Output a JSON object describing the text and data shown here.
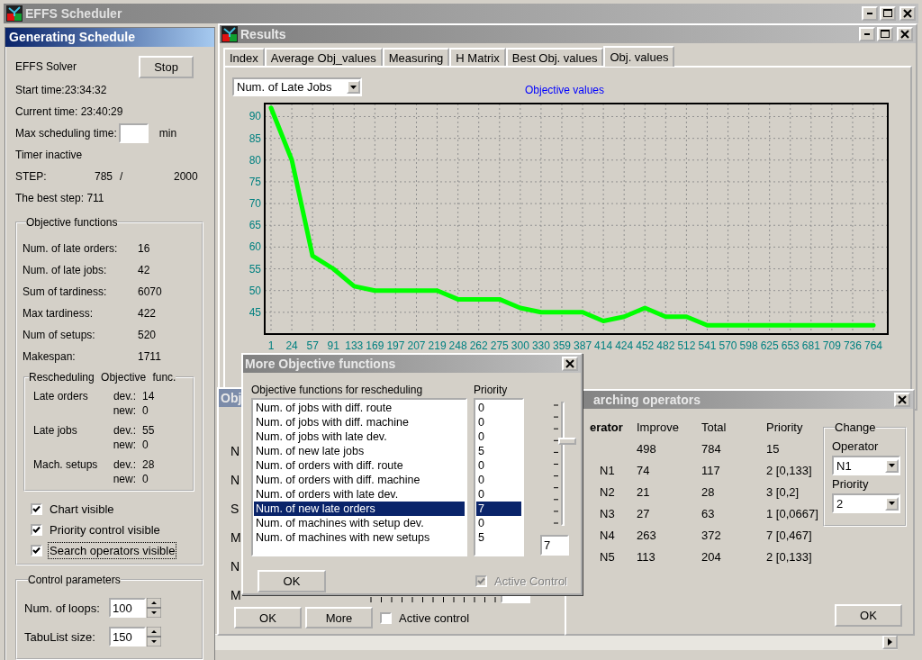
{
  "app": {
    "title": "EFFS Scheduler"
  },
  "generating_panel": {
    "title": "Generating Schedule",
    "solver_label": "EFFS Solver",
    "stop_button": "Stop",
    "start_time": "Start time:23:34:32",
    "current_time": "Current time: 23:40:29",
    "max_time": {
      "label": "Max scheduling time:",
      "unit": "min"
    },
    "timer_status": "Timer inactive",
    "step": {
      "label": "STEP:",
      "current": "785",
      "separator": "/",
      "total": "2000"
    },
    "best_step": "The best step: 711",
    "objective_functions": {
      "title": "Objective functions",
      "rows": [
        {
          "label": "Num. of late orders:",
          "value": "16"
        },
        {
          "label": "Num. of late jobs:",
          "value": "42"
        },
        {
          "label": "Sum of tardiness:",
          "value": "6070"
        },
        {
          "label": "Max tardiness:",
          "value": "422"
        },
        {
          "label": "Num of setups:",
          "value": "520"
        },
        {
          "label": "Makespan:",
          "value": "1711"
        }
      ],
      "rescheduling": {
        "title": "Rescheduling Objective func.",
        "rows": [
          {
            "label": "Late orders",
            "dev_label": "dev.:",
            "dev": "14",
            "new_label": "new:",
            "new": "0"
          },
          {
            "label": "Late jobs",
            "dev_label": "dev.:",
            "dev": "55",
            "new_label": "new:",
            "new": "0"
          },
          {
            "label": "Mach. setups",
            "dev_label": "dev.:",
            "dev": "28",
            "new_label": "new:",
            "new": "0"
          }
        ]
      },
      "checkboxes": [
        {
          "label": "Chart visible",
          "checked": true,
          "focused": false
        },
        {
          "label": "Priority control visible",
          "checked": true,
          "focused": false
        },
        {
          "label": "Search operators visible",
          "checked": true,
          "focused": true
        }
      ]
    },
    "control_parameters": {
      "title": "Control parameters",
      "fields": [
        {
          "label": "Num. of loops:",
          "value": "100"
        },
        {
          "label": "TabuList size:",
          "value": "150"
        }
      ]
    }
  },
  "results_window": {
    "title": "Results",
    "tabs": [
      {
        "label": "Index",
        "selected": false
      },
      {
        "label": "Average Obj_values",
        "selected": false
      },
      {
        "label": "Measuring",
        "selected": false
      },
      {
        "label": "H Matrix",
        "selected": false
      },
      {
        "label": "Best Obj. values",
        "selected": false
      },
      {
        "label": "Obj. values",
        "selected": true
      }
    ],
    "chart_data": {
      "type": "line",
      "title": "Objective values",
      "categories": [
        "1",
        "24",
        "57",
        "91",
        "133",
        "169",
        "197",
        "207",
        "219",
        "248",
        "262",
        "275",
        "300",
        "330",
        "359",
        "387",
        "414",
        "424",
        "452",
        "482",
        "512",
        "541",
        "570",
        "598",
        "625",
        "653",
        "681",
        "709",
        "736",
        "764"
      ],
      "series": [
        {
          "name": "Num. of Late Jobs",
          "color": "#00ff00",
          "values": [
            92,
            80,
            58,
            55,
            51,
            50,
            50,
            50,
            50,
            48,
            48,
            48,
            46,
            45,
            45,
            45,
            43,
            44,
            46,
            44,
            44,
            42,
            42,
            42,
            42,
            42,
            42,
            42,
            42,
            42
          ]
        }
      ],
      "ylim": [
        40,
        93
      ],
      "yticks": [
        45,
        50,
        55,
        60,
        65,
        70,
        75,
        80,
        85,
        90
      ],
      "grid": true
    }
  },
  "objective_window": {
    "title": "Obj",
    "row_labels": [
      "N",
      "N",
      "S",
      "M",
      "N",
      "M"
    ],
    "buttons": [
      "OK",
      "More"
    ],
    "active_control": {
      "label": "Active control",
      "checked": false
    }
  },
  "search_operators_window": {
    "title": "arching operators",
    "columns": [
      "erator",
      "Improve",
      "Total",
      "Priority"
    ],
    "rows": [
      {
        "improve": "498",
        "total": "784",
        "priority": "15"
      },
      {
        "operator": "N1",
        "improve": "74",
        "total": "117",
        "priority": "2 [0,133]"
      },
      {
        "operator": "N2",
        "improve": "21",
        "total": "28",
        "priority": "3 [0,2]"
      },
      {
        "operator": "N3",
        "improve": "27",
        "total": "63",
        "priority": "1 [0,0667]"
      },
      {
        "operator": "N4",
        "improve": "263",
        "total": "372",
        "priority": "7 [0,467]"
      },
      {
        "operator": "N5",
        "improve": "113",
        "total": "204",
        "priority": "2 [0,133]"
      }
    ],
    "change": {
      "title": "Change",
      "operator_label": "Operator",
      "operator_value": "N1",
      "priority_label": "Priority",
      "priority_value": "2"
    },
    "ok_button": "OK"
  },
  "more_dialog": {
    "title": "More Objective functions",
    "list_header": "Objective functions for rescheduling",
    "priority_header": "Priority",
    "items": [
      {
        "name": "Num. of jobs with diff. route",
        "priority": "0",
        "selected": false
      },
      {
        "name": "Num. of jobs with diff. machine",
        "priority": "0",
        "selected": false
      },
      {
        "name": "Num. of jobs with late dev.",
        "priority": "0",
        "selected": false
      },
      {
        "name": "Num. of new late jobs",
        "priority": "5",
        "selected": false
      },
      {
        "name": "Num. of orders with diff. route",
        "priority": "0",
        "selected": false
      },
      {
        "name": "Num. of orders with diff. machine",
        "priority": "0",
        "selected": false
      },
      {
        "name": "Num. of orders with late dev.",
        "priority": "0",
        "selected": false
      },
      {
        "name": "Num. of new late orders",
        "priority": "7",
        "selected": true
      },
      {
        "name": "Num. of machines with setup dev.",
        "priority": "0",
        "selected": false
      },
      {
        "name": "Num. of machines with new setups",
        "priority": "5",
        "selected": false
      }
    ],
    "slider": {
      "level": 0.7
    },
    "priority_value": "7",
    "ok_button": "OK",
    "active_control": {
      "label": "Active Control",
      "checked": true,
      "disabled": true
    }
  }
}
